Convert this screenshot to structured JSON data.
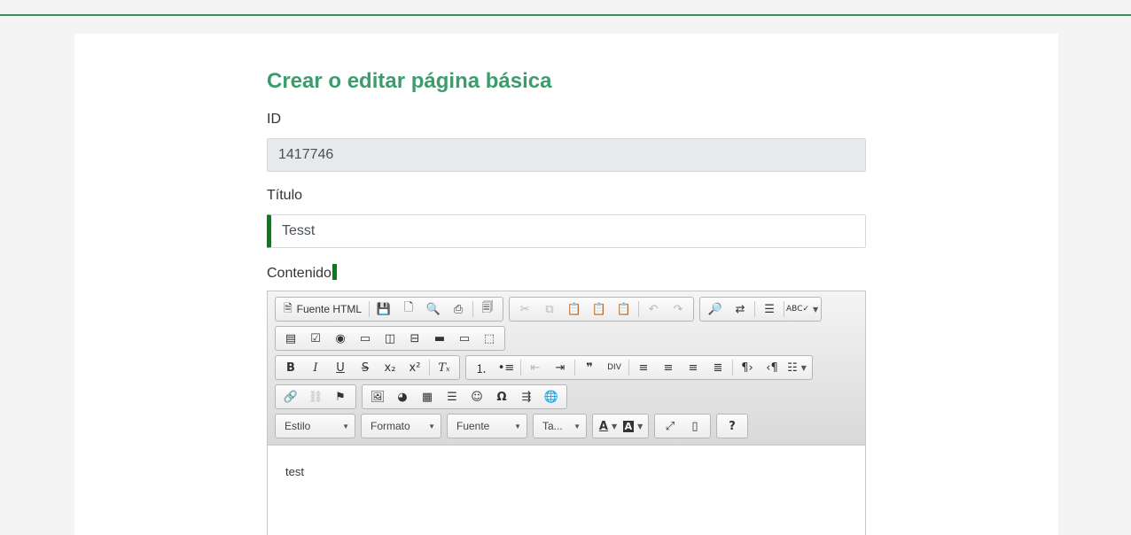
{
  "page": {
    "title": "Crear o editar página básica"
  },
  "fields": {
    "id_label": "ID",
    "id_value": "1417746",
    "title_label": "Título",
    "title_value": "Tesst",
    "content_label": "Contenido"
  },
  "editor": {
    "source_label": "Fuente HTML",
    "combos": {
      "style": "Estilo",
      "format": "Formato",
      "font": "Fuente",
      "size": "Ta..."
    },
    "content_text": "test"
  },
  "colors": {
    "accent_green": "#3d9c6c",
    "required_marker": "#0a7a1a"
  }
}
